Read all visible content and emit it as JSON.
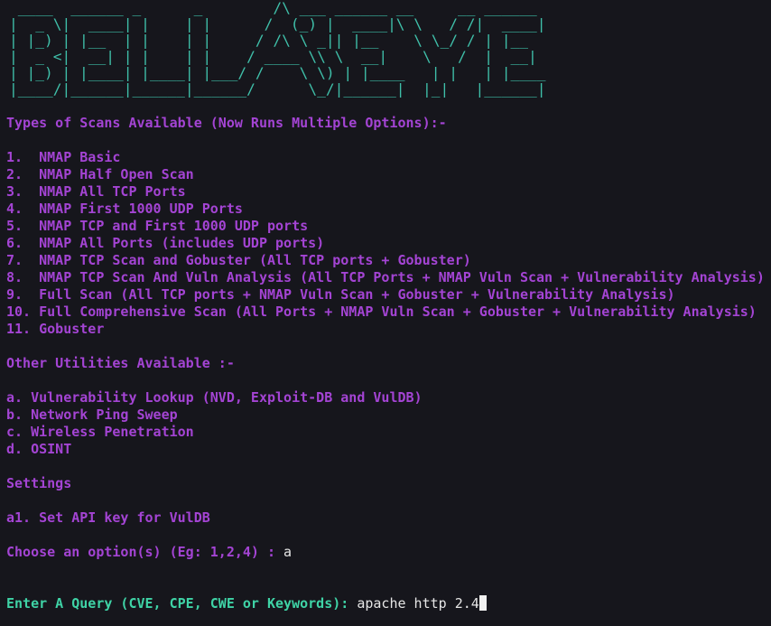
{
  "banner_text": "BELLASEYE",
  "banner_art": [
    " ____  ______ _      _        /\\ ___ ______ __     __ ______",
    "|  _ \\|  ____| |    | |      /  (_) |  ____|\\ \\   / /|  ____|",
    "| |_) | |__  | |    | |     / /\\ \\ _|| |__    \\ \\_/ / | |__",
    "|  _ <|  __| | |    | |    / ____ \\\\ \\  __|    \\   /  |  __|",
    "| |_) | |____| |____| |___/ /    \\ \\) | |____   | |   | |____",
    "|____/|______|______|______/      \\_/|______|  |_|   |______|"
  ],
  "scans_heading": "Types of Scans Available (Now Runs Multiple Options):-",
  "scan_options": [
    "1.  NMAP Basic",
    "2.  NMAP Half Open Scan",
    "3.  NMAP All TCP Ports",
    "4.  NMAP First 1000 UDP Ports",
    "5.  NMAP TCP and First 1000 UDP ports",
    "6.  NMAP All Ports (includes UDP ports)",
    "7.  NMAP TCP Scan and Gobuster (All TCP ports + Gobuster)",
    "8.  NMAP TCP Scan And Vuln Analysis (All TCP Ports + NMAP Vuln Scan + Vulnerability Analysis)",
    "9.  Full Scan (All TCP ports + NMAP Vuln Scan + Gobuster + Vulnerability Analysis)",
    "10. Full Comprehensive Scan (All Ports + NMAP Vuln Scan + Gobuster + Vulnerability Analysis)",
    "11. Gobuster"
  ],
  "utilities_heading": "Other Utilities Available :-",
  "utility_options": [
    "a. Vulnerability Lookup (NVD, Exploit-DB and VulDB)",
    "b. Network Ping Sweep",
    "c. Wireless Penetration",
    "d. OSINT"
  ],
  "settings_heading": "Settings",
  "settings_options": [
    "a1. Set API key for VulDB"
  ],
  "choose_prompt": "Choose an option(s) (Eg: 1,2,4) : ",
  "choose_value": "a",
  "query_prompt": "Enter A Query (CVE, CPE, CWE or Keywords): ",
  "query_value": "apache http 2.4",
  "colors": {
    "background": "#16161c",
    "banner": "#3fbfa9",
    "heading": "#a444d4",
    "prompt": "#3fd3a6",
    "input": "#e6e6e6"
  }
}
